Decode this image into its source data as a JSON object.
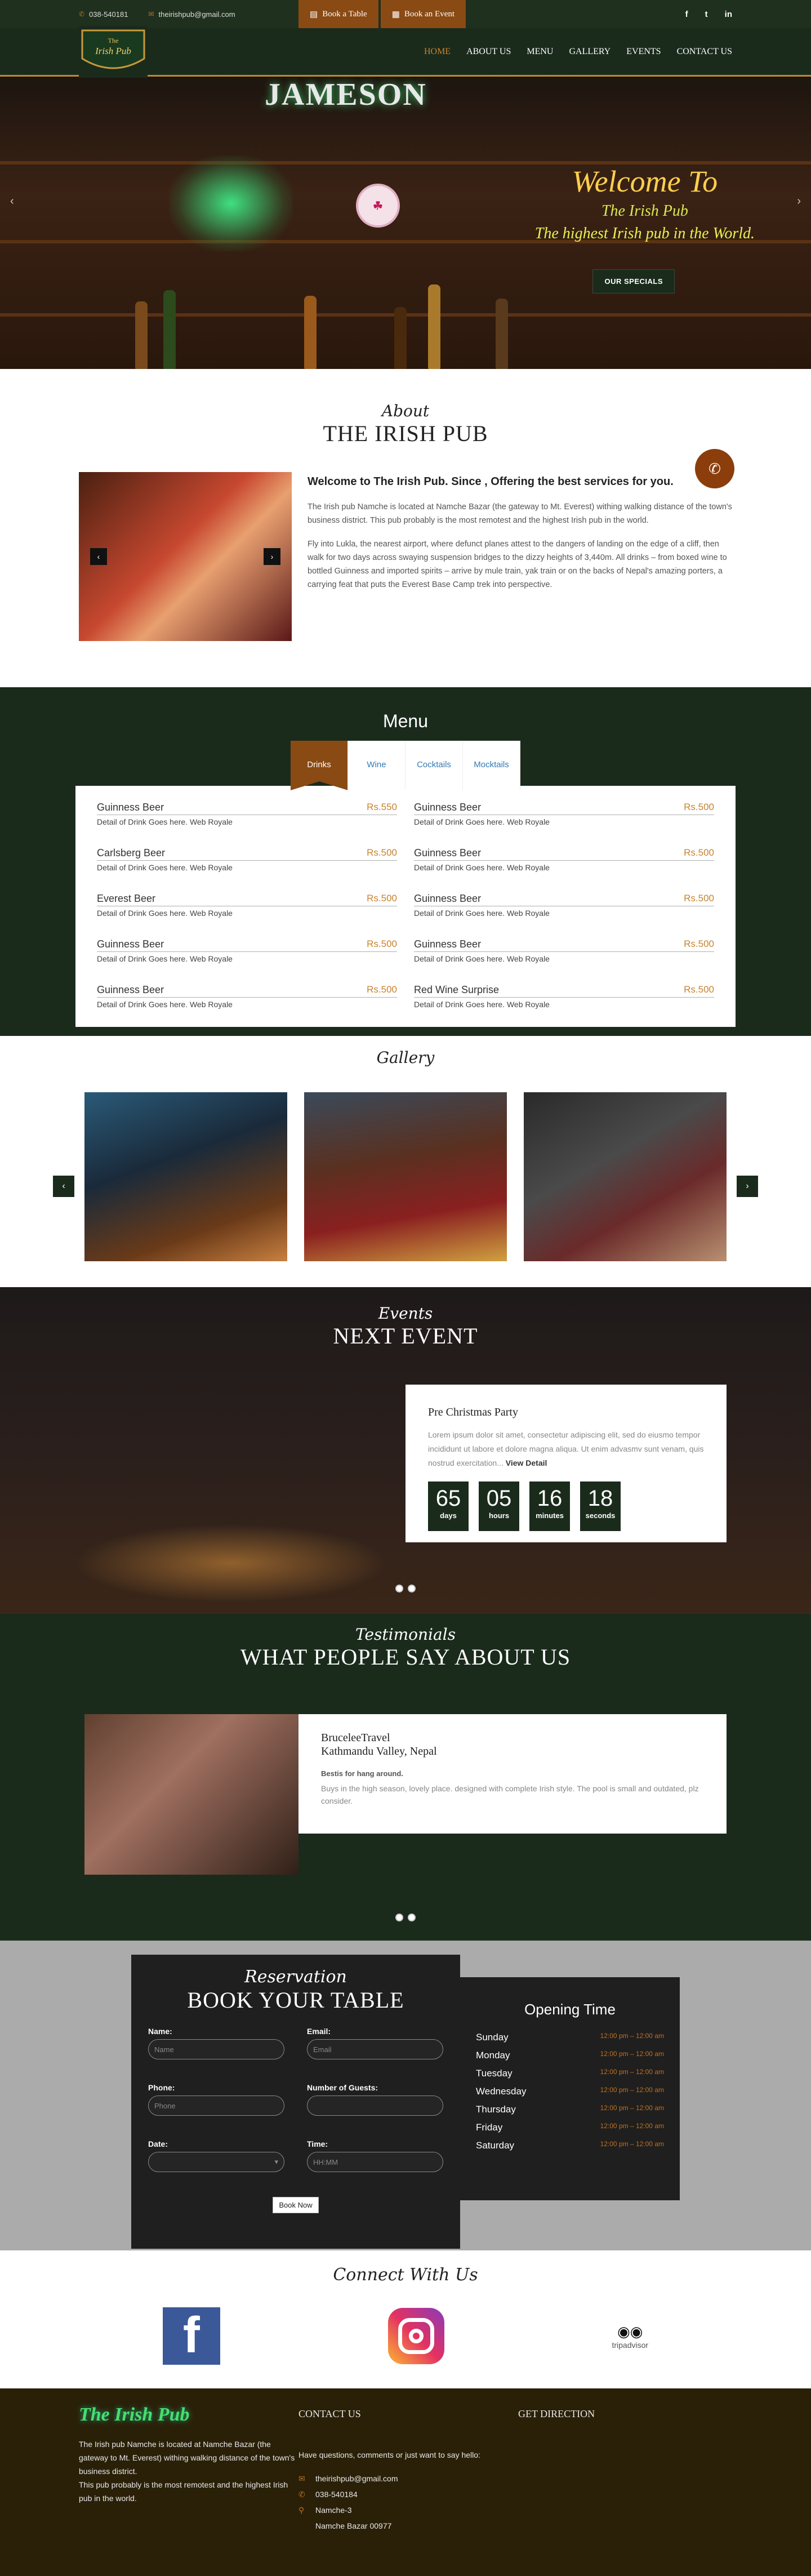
{
  "topbar": {
    "phone": "038-540181",
    "email": "theirishpub@gmail.com",
    "book_table": "Book a Table",
    "book_event": "Book an Event",
    "social": [
      "f",
      "t",
      "in"
    ]
  },
  "nav": {
    "logo_top": "The",
    "logo_name": "Irish Pub",
    "items": [
      "HOME",
      "ABOUT US",
      "MENU",
      "GALLERY",
      "EVENTS",
      "CONTACT US"
    ],
    "active": "HOME"
  },
  "hero": {
    "sign": "JAMESON",
    "title": "Welcome To",
    "subtitle": "The Irish Pub",
    "tagline": "The highest Irish pub in the World.",
    "button": "OUR SPECIALS",
    "prev": "‹",
    "next": "›"
  },
  "about": {
    "script": "About",
    "title": "THE IRISH PUB",
    "heading": "Welcome to The Irish Pub. Since , Offering the best services for you.",
    "para1": "The Irish pub Namche is located at Namche Bazar (the gateway to Mt. Everest) withing walking distance of the town's business district. This pub probably is the most remotest and the highest Irish pub in the world.",
    "para2": "Fly into Lukla, the nearest airport, where defunct planes attest to the dangers of landing on the edge of a cliff, then walk for two days across swaying suspension bridges to the dizzy heights of 3,440m. All drinks – from boxed wine to bottled Guinness and imported spirits – arrive by mule train, yak train or on the backs of Nepal's amazing porters, a carrying feat that puts the Everest Base Camp trek into perspective.",
    "img_prev": "‹",
    "img_next": "›",
    "call_icon": "phone-icon"
  },
  "menu": {
    "title": "Menu",
    "tabs": [
      "Drinks",
      "Wine",
      "Cocktails",
      "Mocktails"
    ],
    "active_tab": "Drinks",
    "items": [
      {
        "name": "Guinness Beer",
        "price": "Rs.550",
        "desc": "Detail of Drink Goes here. Web Royale"
      },
      {
        "name": "Guinness Beer",
        "price": "Rs.500",
        "desc": "Detail of Drink Goes here. Web Royale"
      },
      {
        "name": "Carlsberg Beer",
        "price": "Rs.500",
        "desc": "Detail of Drink Goes here. Web Royale"
      },
      {
        "name": "Guinness Beer",
        "price": "Rs.500",
        "desc": "Detail of Drink Goes here. Web Royale"
      },
      {
        "name": "Everest Beer",
        "price": "Rs.500",
        "desc": "Detail of Drink Goes here. Web Royale"
      },
      {
        "name": "Guinness Beer",
        "price": "Rs.500",
        "desc": "Detail of Drink Goes here. Web Royale"
      },
      {
        "name": "Guinness Beer",
        "price": "Rs.500",
        "desc": "Detail of Drink Goes here. Web Royale"
      },
      {
        "name": "Guinness Beer",
        "price": "Rs.500",
        "desc": "Detail of Drink Goes here. Web Royale"
      },
      {
        "name": "Guinness Beer",
        "price": "Rs.500",
        "desc": "Detail of Drink Goes here. Web Royale"
      },
      {
        "name": "Red Wine Surprise",
        "price": "Rs.500",
        "desc": "Detail of Drink Goes here. Web Royale"
      }
    ]
  },
  "gallery": {
    "script": "Gallery",
    "prev": "‹",
    "next": "›"
  },
  "events": {
    "script": "Events",
    "title": "NEXT EVENT",
    "event_title": "Pre Christmas Party",
    "event_desc": "Lorem ipsum dolor sit amet, consectetur adipiscing elit, sed do eiusmo tempor incididunt ut labore et dolore magna aliqua. Ut enim advasmv sunt venam, quis nostrud exercitation...",
    "view_detail": "View Detail",
    "countdown": [
      {
        "value": "65",
        "label": "days"
      },
      {
        "value": "05",
        "label": "hours"
      },
      {
        "value": "16",
        "label": "minutes"
      },
      {
        "value": "18",
        "label": "seconds"
      }
    ]
  },
  "testimonials": {
    "script": "Testimonials",
    "title": "WHAT PEOPLE SAY ABOUT US",
    "name": "BruceleeTravel",
    "location": "Kathmandu Valley, Nepal",
    "headline": "Bestis for hang around.",
    "text": "Buys in the high season, lovely place. designed with complete Irish style. The pool is small and outdated, plz consider."
  },
  "reservation": {
    "script": "Reservation",
    "title": "BOOK YOUR TABLE",
    "fields": [
      {
        "label": "Name:",
        "placeholder": "Name"
      },
      {
        "label": "Email:",
        "placeholder": "Email"
      },
      {
        "label": "Phone:",
        "placeholder": "Phone"
      },
      {
        "label": "Number of Guests:",
        "placeholder": ""
      },
      {
        "label": "Date:",
        "placeholder": ""
      },
      {
        "label": "Time:",
        "placeholder": "HH:MM"
      }
    ],
    "button": "Book Now"
  },
  "opening": {
    "title": "Opening Time",
    "days": [
      {
        "day": "Sunday",
        "time": "12:00 pm – 12:00 am"
      },
      {
        "day": "Monday",
        "time": "12:00 pm – 12:00 am"
      },
      {
        "day": "Tuesday",
        "time": "12:00 pm – 12:00 am"
      },
      {
        "day": "Wednesday",
        "time": "12:00 pm – 12:00 am"
      },
      {
        "day": "Thursday",
        "time": "12:00 pm – 12:00 am"
      },
      {
        "day": "Friday",
        "time": "12:00 pm – 12:00 am"
      },
      {
        "day": "Saturday",
        "time": "12:00 pm – 12:00 am"
      }
    ]
  },
  "connect": {
    "script": "Connect With Us",
    "fb": "f",
    "tripadvisor": "tripadvisor"
  },
  "footer": {
    "logo": "The Irish Pub",
    "about": "The Irish pub Namche is located at Namche Bazar (the gateway to Mt. Everest) withing walking distance of the town's business district.",
    "about2": "This pub probably is the most remotest and the highest Irish pub in the world.",
    "contact_title": "CONTACT US",
    "contact_intro": "Have questions, comments or just want to say hello:",
    "email": "theirishpub@gmail.com",
    "phone": "038-540184",
    "addr1": "Namche-3",
    "addr2": "Namche Bazar 00977",
    "direction_title": "GET DIRECTION"
  }
}
